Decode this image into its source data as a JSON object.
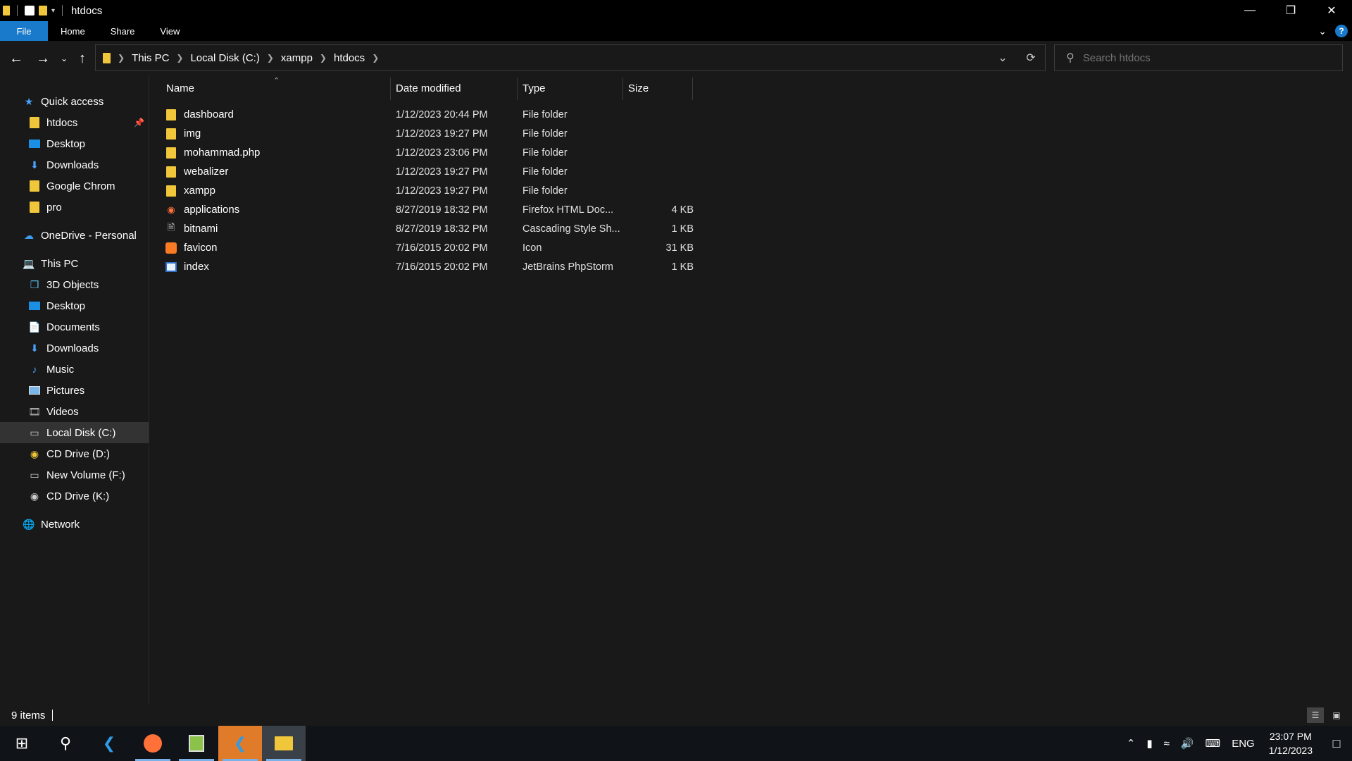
{
  "window": {
    "title": "htdocs"
  },
  "ribbon": {
    "tabs": [
      "File",
      "Home",
      "Share",
      "View"
    ]
  },
  "address": {
    "crumbs": [
      "This PC",
      "Local Disk (C:)",
      "xampp",
      "htdocs"
    ]
  },
  "search": {
    "placeholder": "Search htdocs"
  },
  "sidebar": {
    "quick_access": "Quick access",
    "quick_items": [
      "htdocs",
      "Desktop",
      "Downloads",
      "Google Chrom",
      "pro"
    ],
    "onedrive": "OneDrive - Personal",
    "this_pc": "This PC",
    "pc_items": [
      "3D Objects",
      "Desktop",
      "Documents",
      "Downloads",
      "Music",
      "Pictures",
      "Videos",
      "Local Disk (C:)",
      "CD Drive (D:)",
      "New Volume (F:)",
      "CD Drive (K:)"
    ],
    "network": "Network"
  },
  "columns": {
    "name": "Name",
    "date": "Date modified",
    "type": "Type",
    "size": "Size"
  },
  "files": [
    {
      "name": "dashboard",
      "date": "1/12/2023 20:44 PM",
      "type": "File folder",
      "size": "",
      "icon": "folder-icon"
    },
    {
      "name": "img",
      "date": "1/12/2023 19:27 PM",
      "type": "File folder",
      "size": "",
      "icon": "folder-icon"
    },
    {
      "name": "mohammad.php",
      "date": "1/12/2023 23:06 PM",
      "type": "File folder",
      "size": "",
      "icon": "folder-icon"
    },
    {
      "name": "webalizer",
      "date": "1/12/2023 19:27 PM",
      "type": "File folder",
      "size": "",
      "icon": "folder-icon"
    },
    {
      "name": "xampp",
      "date": "1/12/2023 19:27 PM",
      "type": "File folder",
      "size": "",
      "icon": "folder-icon"
    },
    {
      "name": "applications",
      "date": "8/27/2019 18:32 PM",
      "type": "Firefox HTML Doc...",
      "size": "4 KB",
      "icon": "firefox-html-icon"
    },
    {
      "name": "bitnami",
      "date": "8/27/2019 18:32 PM",
      "type": "Cascading Style Sh...",
      "size": "1 KB",
      "icon": "css-file-icon"
    },
    {
      "name": "favicon",
      "date": "7/16/2015 20:02 PM",
      "type": "Icon",
      "size": "31 KB",
      "icon": "xampp-icon"
    },
    {
      "name": "index",
      "date": "7/16/2015 20:02 PM",
      "type": "JetBrains PhpStorm",
      "size": "1 KB",
      "icon": "phpstorm-file-icon"
    }
  ],
  "status": {
    "item_count": "9 items"
  },
  "taskbar": {
    "lang": "ENG",
    "time": "23:07 PM",
    "date": "1/12/2023"
  },
  "colors": {
    "accent": "#1979ca",
    "folder": "#f0c63a",
    "active_app": "#e07b29"
  }
}
